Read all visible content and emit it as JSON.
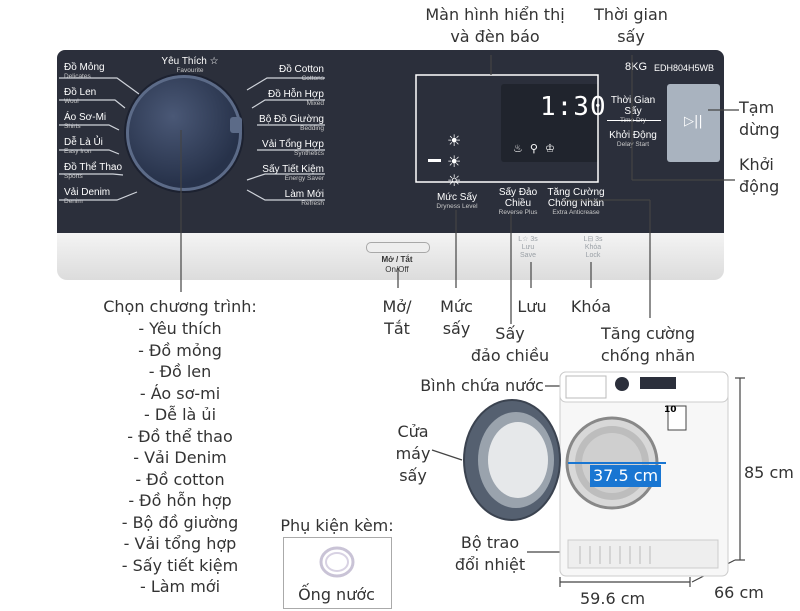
{
  "panel": {
    "capacity": "8KG",
    "model": "EDH804H5WB",
    "favourite": {
      "vi": "Yêu Thích ☆",
      "en": "Favourite"
    },
    "left_programs": [
      {
        "vi": "Đồ Mỏng",
        "en": "Delicates"
      },
      {
        "vi": "Đồ Len",
        "en": "Wool"
      },
      {
        "vi": "Áo Sơ-Mi",
        "en": "Shirts"
      },
      {
        "vi": "Dễ Là Ủi",
        "en": "Easy Iron"
      },
      {
        "vi": "Đồ Thể Thao",
        "en": "Sports"
      },
      {
        "vi": "Vải Denim",
        "en": "Denim"
      }
    ],
    "right_programs": [
      {
        "vi": "Đồ Cotton",
        "en": "Cottons"
      },
      {
        "vi": "Đồ Hỗn Hợp",
        "en": "Mixed"
      },
      {
        "vi": "Bộ Đồ Giường",
        "en": "Bedding"
      },
      {
        "vi": "Vải Tổng Hợp",
        "en": "Synthetics"
      },
      {
        "vi": "Sấy Tiết Kiệm",
        "en": "Energy Saver"
      },
      {
        "vi": "Làm Mới",
        "en": "Refresh"
      }
    ],
    "time_display": "1:30",
    "time_dry": {
      "vi": "Thời Gian Sấy",
      "en": "Time Dry"
    },
    "delay_start": {
      "vi": "Khởi Động",
      "en": "Delay Start"
    },
    "dryness": {
      "vi": "Mức Sấy",
      "en": "Dryness Level"
    },
    "reverse": {
      "vi": "Sấy Đảo Chiều",
      "en": "Reverse Plus"
    },
    "anticrease": {
      "vi": "Tăng Cường Chống Nhăn",
      "en": "Extra Anticrease"
    },
    "onoff": {
      "vi": "Mở / Tắt",
      "en": "On/Off"
    },
    "save": {
      "top": "L☆ 3s",
      "vi": "Lưu",
      "en": "Save"
    },
    "lock": {
      "top": "L⊟ 3s",
      "vi": "Khóa",
      "en": "Lock"
    }
  },
  "callouts": {
    "display": "Màn hình hiển thị\nvà đèn báo",
    "drying_time": "Thời gian\nsấy",
    "pause": "Tạm\ndừng",
    "start": "Khởi\nđộng",
    "onoff": "Mở/\nTắt",
    "dryness": "Mức\nsấy",
    "save": "Lưu",
    "lock": "Khóa",
    "reverse": "Sấy\nđảo chiều",
    "anticrease": "Tăng cường\nchống nhăn",
    "water_tank": "Bình chứa nước",
    "door": "Cửa\nmáy\nsấy",
    "heat_exchanger": "Bộ trao\nđổi nhiệt"
  },
  "program_list": {
    "title": "Chọn chương trình:",
    "items": [
      "- Yêu thích",
      "- Đồ mỏng",
      "- Đồ len",
      "- Áo sơ-mi",
      "- Dễ là ủi",
      "- Đồ thể thao",
      "- Vải Denim",
      "- Đồ cotton",
      "- Đồ hỗn hợp",
      "- Bộ đồ giường",
      "- Vải tổng hợp",
      "- Sấy tiết kiệm",
      "- Làm mới"
    ]
  },
  "accessory": {
    "title": "Phụ kiện kèm:",
    "item": "Ống nước"
  },
  "dimensions": {
    "door": "37.5 cm",
    "height": "85 cm",
    "width": "59.6 cm",
    "depth": "66 cm"
  },
  "dryer_badge": "10"
}
